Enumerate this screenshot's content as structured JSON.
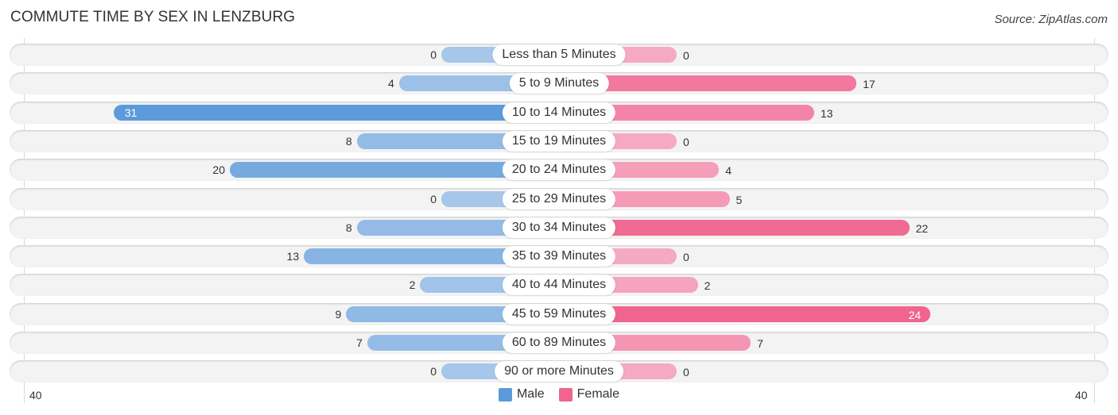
{
  "chart_data": {
    "type": "bar",
    "orientation": "horizontal-diverging",
    "title": "COMMUTE TIME BY SEX IN LENZBURG",
    "source": "Source: ZipAtlas.com",
    "categories": [
      "Less than 5 Minutes",
      "5 to 9 Minutes",
      "10 to 14 Minutes",
      "15 to 19 Minutes",
      "20 to 24 Minutes",
      "25 to 29 Minutes",
      "30 to 34 Minutes",
      "35 to 39 Minutes",
      "40 to 44 Minutes",
      "45 to 59 Minutes",
      "60 to 89 Minutes",
      "90 or more Minutes"
    ],
    "series": [
      {
        "name": "Male",
        "side": "left",
        "color": "#5b9bd9",
        "light_color": "#a6c6ea",
        "values": [
          0,
          4,
          31,
          8,
          20,
          0,
          8,
          13,
          2,
          9,
          7,
          0
        ]
      },
      {
        "name": "Female",
        "side": "right",
        "color": "#f0648f",
        "light_color": "#f6a9c3",
        "values": [
          0,
          17,
          13,
          0,
          4,
          5,
          22,
          0,
          2,
          24,
          7,
          0
        ]
      }
    ],
    "axis": {
      "left_label": "40",
      "right_label": "40",
      "range": [
        -40,
        40
      ]
    },
    "legend": {
      "position": "bottom-center",
      "items": [
        "Male",
        "Female"
      ]
    }
  }
}
